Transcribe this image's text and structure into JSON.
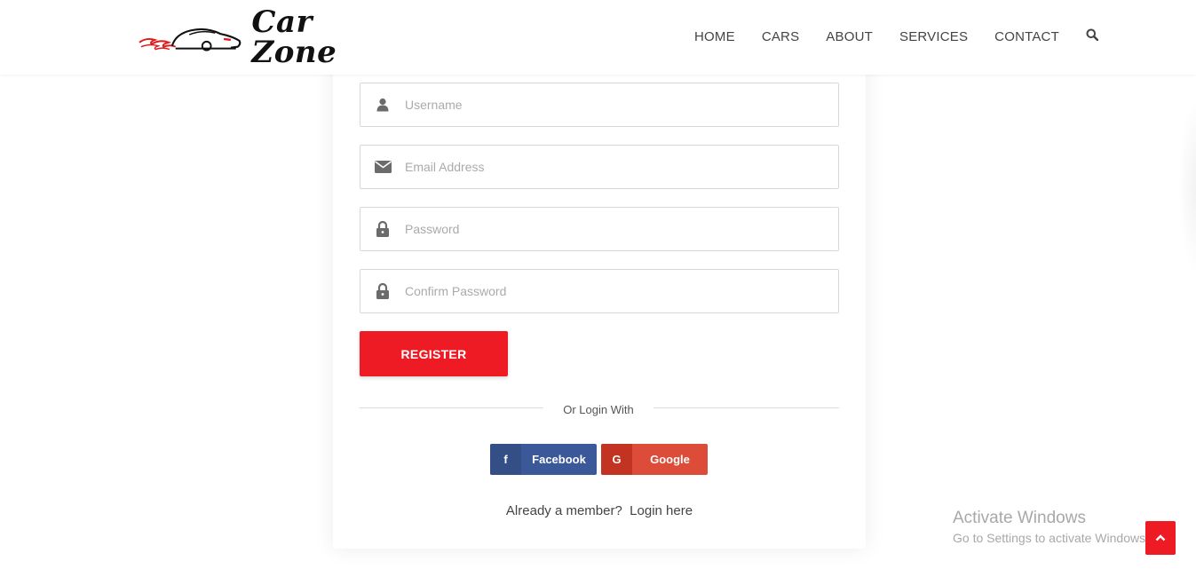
{
  "brand": {
    "name": "Car Zone",
    "logo_icon": "car-flame-logo",
    "accent": "#ee1a24"
  },
  "nav": {
    "items": [
      "HOME",
      "CARS",
      "ABOUT",
      "SERVICES",
      "CONTACT"
    ],
    "search_icon": "search-icon"
  },
  "form": {
    "username_placeholder": "Username",
    "email_placeholder": "Email Address",
    "password_placeholder": "Password",
    "confirm_password_placeholder": "Confirm Password",
    "register_label": "REGISTER"
  },
  "social": {
    "divider_text": "Or Login With",
    "facebook_label": "Facebook",
    "facebook_icon_glyph": "f",
    "google_label": "Google",
    "google_icon_glyph": "G",
    "facebook_color": "#3b5998",
    "google_color": "#dd4b39"
  },
  "footer_link": {
    "prefix": "Already a member?",
    "link": "Login here"
  },
  "watermark": {
    "title": "Activate Windows",
    "subtitle": "Go to Settings to activate Windows."
  }
}
